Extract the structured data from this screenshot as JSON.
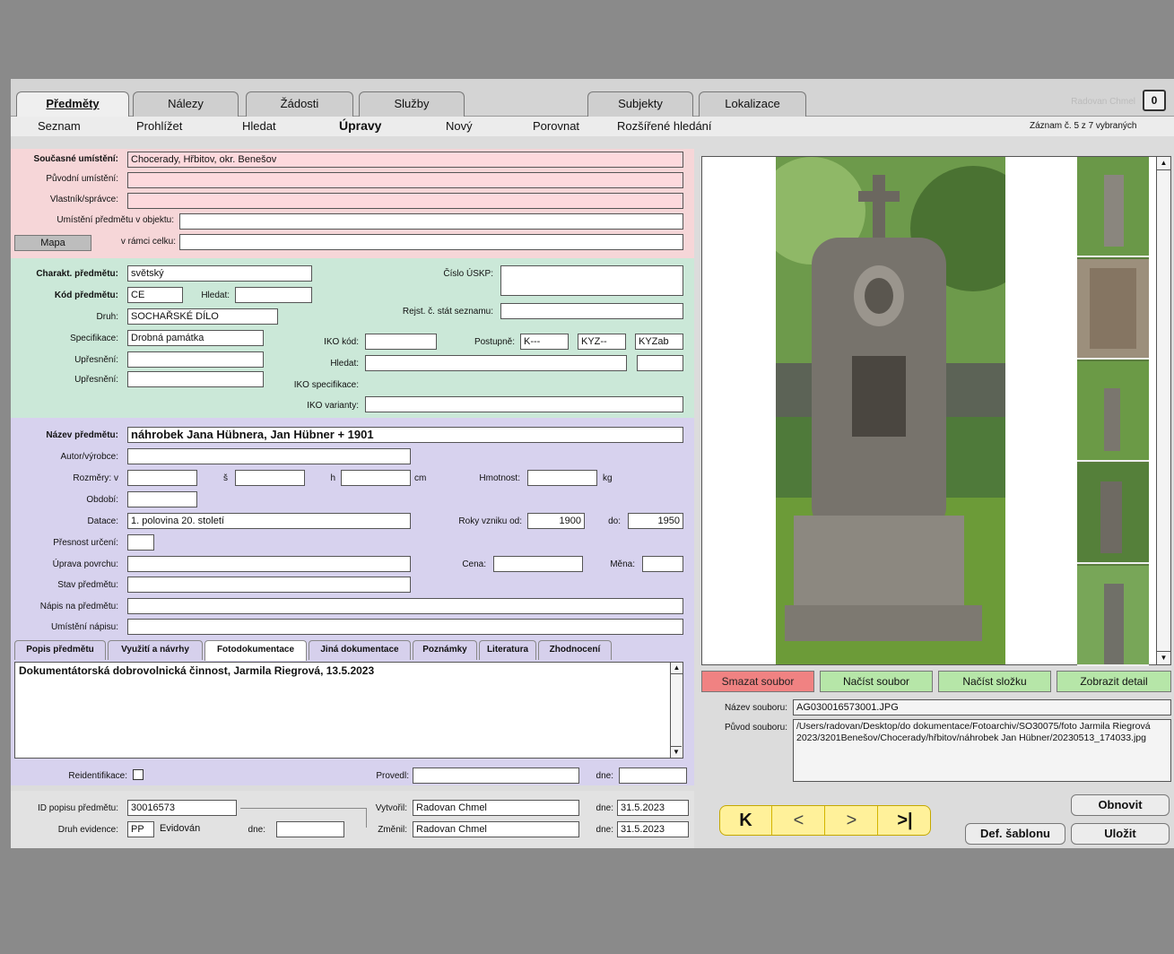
{
  "tabs": [
    "Předměty",
    "Nálezy",
    "Žádosti",
    "Služby",
    "Subjekty",
    "Lokalizace"
  ],
  "user": "Radovan Chmel",
  "lock_count": "0",
  "subnav": [
    "Seznam",
    "Prohlížet",
    "Hledat",
    "Úpravy",
    "Nový",
    "Porovnat",
    "Rozšířené hledání"
  ],
  "record_info": "Záznam č. 5 z 7 vybraných",
  "location": {
    "current_label": "Současné umístění:",
    "current_value": "Chocerady, Hřbitov, okr. Benešov",
    "original_label": "Původní umístění:",
    "owner_label": "Vlastník/správce:",
    "in_object_label": "Umístění předmětu v objektu:",
    "map_button": "Mapa",
    "in_whole_label": "v rámci celku:"
  },
  "character": {
    "charakt_label": "Charakt. předmětu:",
    "charakt_value": "světský",
    "code_label": "Kód předmětu:",
    "code_value": "CE",
    "search_label": "Hledat:",
    "type_label": "Druh:",
    "type_value": "SOCHAŘSKÉ DÍLO",
    "spec_label": "Specifikace:",
    "spec_value": "Drobná památka",
    "refine1_label": "Upřesnění:",
    "refine2_label": "Upřesnění:",
    "uskp_label": "Číslo ÚSKP:",
    "register_label": "Rejst. č. stát seznamu:",
    "iko_code_label": "IKO kód:",
    "gradual_label": "Postupně:",
    "gradual_values": [
      "K---",
      "KYZ--",
      "KYZab"
    ],
    "iko_search_label": "Hledat:",
    "iko_spec_label": "IKO specifikace:",
    "iko_var_label": "IKO varianty:"
  },
  "object": {
    "name_label": "Název předmětu:",
    "name_value": "náhrobek Jana Hübnera, Jan Hübner + 1901",
    "author_label": "Autor/výrobce:",
    "dims_label": "Rozměry:",
    "dim_v": "v",
    "dim_s": "š",
    "dim_h": "h",
    "unit_cm": "cm",
    "weight_label": "Hmotnost:",
    "unit_kg": "kg",
    "period_label": "Období:",
    "dating_label": "Datace:",
    "dating_value": "1. polovina 20. století",
    "years_from_label": "Roky vzniku od:",
    "year_from": "1900",
    "year_to_label": "do:",
    "year_to": "1950",
    "precision_label": "Přesnost určení:",
    "surface_label": "Úprava povrchu:",
    "price_label": "Cena:",
    "currency_label": "Měna:",
    "condition_label": "Stav předmětu:",
    "inscription_label": "Nápis na předmětu:",
    "inscription_loc_label": "Umístění nápisu:"
  },
  "subtabs": [
    "Popis předmětu",
    "Využití a návrhy",
    "Fotodokumentace",
    "Jiná dokumentace",
    "Poznámky",
    "Literatura",
    "Zhodnocení"
  ],
  "photo_doc_text": "Dokumentátorská dobrovolnická činnost, Jarmila Riegrová, 13.5.2023",
  "reident_label": "Reidentifikace:",
  "provedl_label": "Provedl:",
  "dne_label": "dne:",
  "footer": {
    "id_label": "ID popisu předmětu:",
    "id_value": "30016573",
    "evid_label": "Druh evidence:",
    "evid_code": "PP",
    "evid_value": "Evidován",
    "evid_dne": "dne:",
    "created_label": "Vytvořil:",
    "created_by": "Radovan Chmel",
    "created_date": "31.5.2023",
    "changed_label": "Změnil:",
    "changed_by": "Radovan Chmel",
    "changed_date": "31.5.2023",
    "dne_label": "dne:"
  },
  "file_buttons": {
    "delete": "Smazat soubor",
    "load_file": "Načíst soubor",
    "load_folder": "Načíst složku",
    "detail": "Zobrazit detail"
  },
  "file": {
    "name_label": "Název souboru:",
    "name_value": "AG030016573001.JPG",
    "origin_label": "Původ souboru:",
    "origin_value": "/Users/radovan/Desktop/do dokumentace/Fotoarchiv/SO30075/foto Jarmila Riegrová 2023/3201Benešov/Chocerady/hřbitov/náhrobek Jan Hübner/20230513_174033.jpg"
  },
  "nav_buttons": [
    "K",
    "<",
    ">",
    ">|"
  ],
  "action_buttons": {
    "refresh": "Obnovit",
    "template": "Def. šablonu",
    "save": "Uložit"
  },
  "colors": {
    "location_bg": "#f6d6d8",
    "character_bg": "#cbe8d8",
    "object_bg": "#d7d2ee",
    "delete_btn": "#f08282",
    "green_btn": "#b6e6a8",
    "nav_yellow": "#fff19a"
  }
}
